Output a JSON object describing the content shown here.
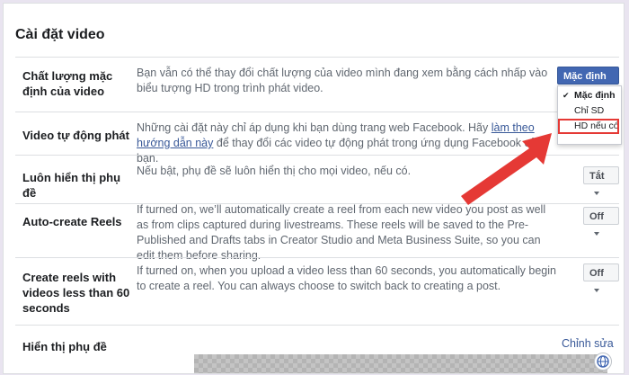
{
  "page": {
    "title": "Cài đặt video"
  },
  "rows": [
    {
      "label": "Chất lượng mặc định của video",
      "desc": "Bạn vẫn có thể thay đổi chất lượng của video mình đang xem bằng cách nhấp vào biểu tượng HD trong trình phát video.",
      "button": "Mặc định"
    },
    {
      "label": "Video tự động phát",
      "desc_before": "Những cài đặt này chỉ áp dụng khi bạn dùng trang web Facebook. Hãy ",
      "desc_link": "làm theo hướng dẫn này",
      "desc_after": " để thay đổi các video tự động phát trong ứng dụng Facebook của bạn."
    },
    {
      "label": "Luôn hiển thị phụ đề",
      "desc": "Nếu bật, phụ đề sẽ luôn hiển thị cho mọi video, nếu có.",
      "button": "Tắt"
    },
    {
      "label": "Auto-create Reels",
      "desc": "If turned on, we’ll automatically create a reel from each new video you post as well as from clips captured during livestreams. These reels will be saved to the Pre-Published and Drafts tabs in Creator Studio and Meta Business Suite, so you can edit them before sharing.",
      "button": "Off"
    },
    {
      "label": "Create reels with videos less than 60 seconds",
      "desc": "If turned on, when you upload a video less than 60 seconds, you automatically begin to create a reel. You can always choose to switch back to creating a post.",
      "button": "Off"
    },
    {
      "label": "Hiển thị phụ đề",
      "link": "Chỉnh sửa"
    }
  ],
  "dropdown": {
    "options": [
      "Mặc định",
      "Chỉ SD",
      "HD nếu có"
    ],
    "selected": "Mặc định",
    "check": "✔"
  },
  "annotation_color": "#e53935",
  "accent_color": "#4267b2"
}
